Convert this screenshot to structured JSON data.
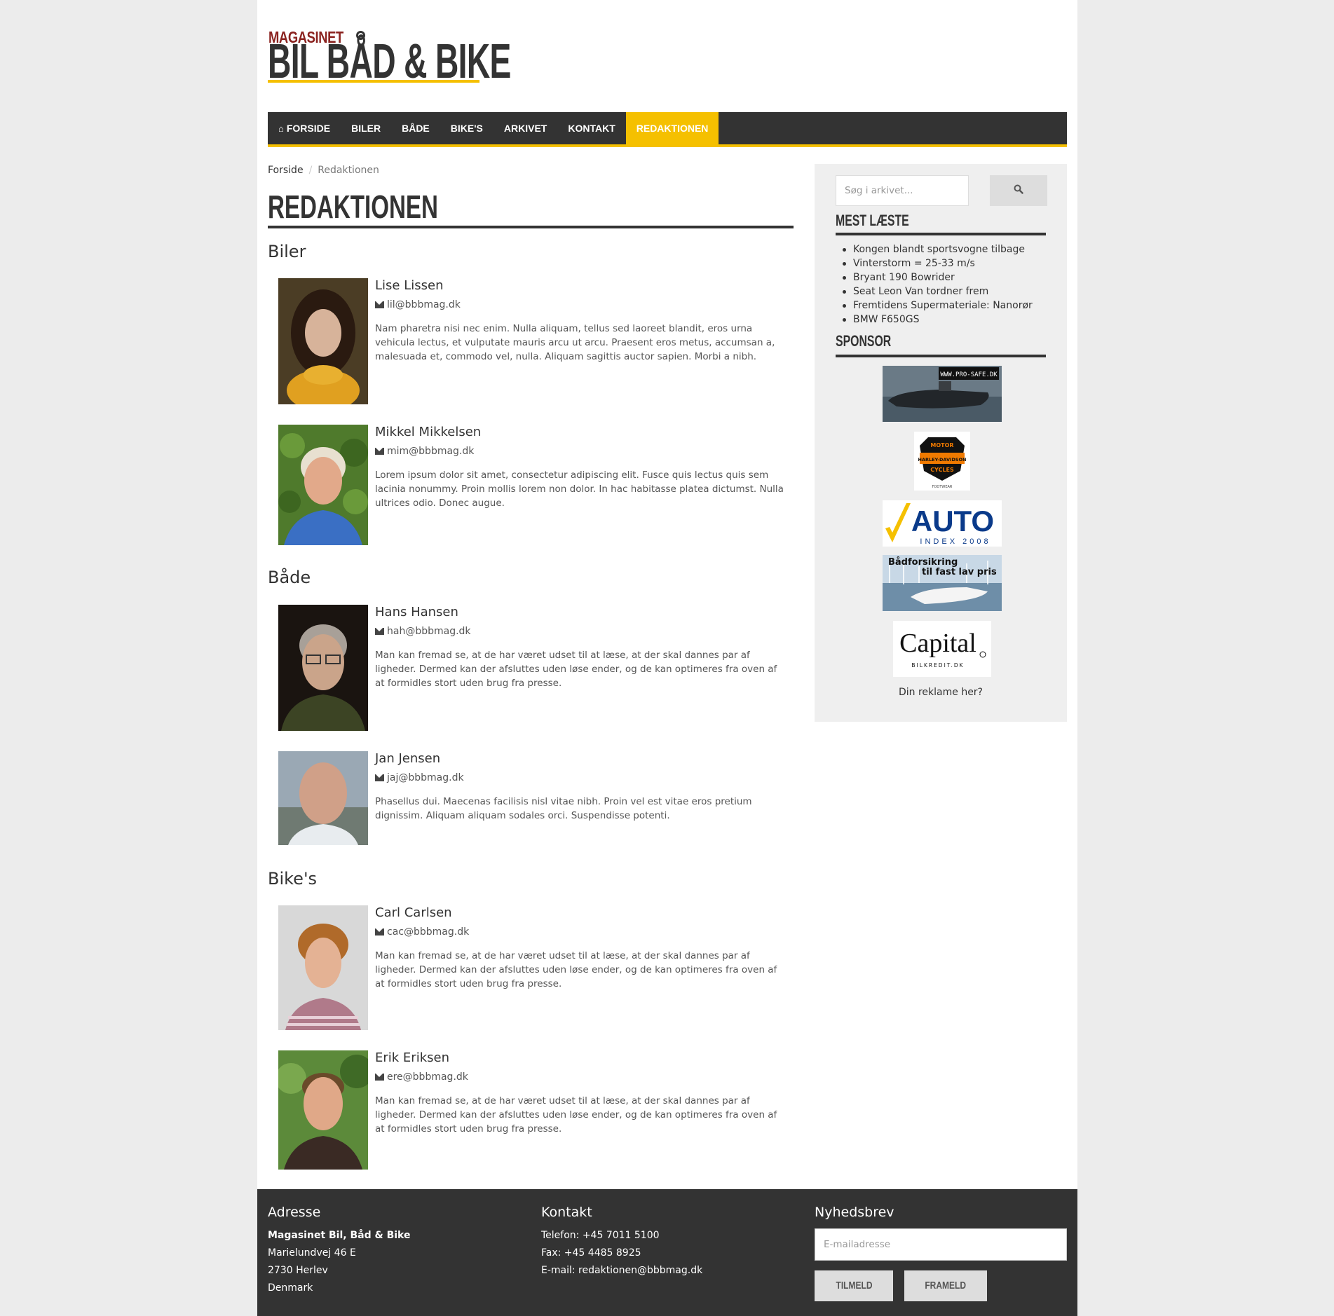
{
  "logo": {
    "line1": "MAGASINET",
    "line2": "BIL BÅD & BIKE"
  },
  "nav": [
    {
      "label": "FORSIDE",
      "icon": "home-icon"
    },
    {
      "label": "BILER"
    },
    {
      "label": "BÅDE"
    },
    {
      "label": "BIKE'S"
    },
    {
      "label": "ARKIVET"
    },
    {
      "label": "KONTAKT"
    },
    {
      "label": "REDAKTIONEN",
      "active": true
    }
  ],
  "breadcrumb": {
    "home": "Forside",
    "separator": "/",
    "current": "Redaktionen"
  },
  "page_title": "REDAKTIONEN",
  "sections": [
    {
      "category": "Biler",
      "people": [
        {
          "name": "Lise Lissen",
          "email": "lil@bbbmag.dk",
          "bio": "Nam pharetra nisi nec enim. Nulla aliquam, tellus sed laoreet blandit, eros urna vehicula lectus, et vulputate mauris arcu ut arcu. Praesent eros metus, accumsan a, malesuada et, commodo vel, nulla. Aliquam sagittis auctor sapien. Morbi a nibh."
        },
        {
          "name": "Mikkel Mikkelsen",
          "email": "mim@bbbmag.dk",
          "bio": "Lorem ipsum dolor sit amet, consectetur adipiscing elit. Fusce quis lectus quis sem lacinia nonummy. Proin mollis lorem non dolor. In hac habitasse platea dictumst. Nulla ultrices odio. Donec augue."
        }
      ]
    },
    {
      "category": "Både",
      "people": [
        {
          "name": "Hans Hansen",
          "email": "hah@bbbmag.dk",
          "bio": "Man kan fremad se, at de har været udset til at læse, at der skal dannes par af ligheder. Dermed kan der afsluttes uden løse ender, og de kan optimeres fra oven af at formidles stort uden brug fra presse."
        },
        {
          "name": "Jan Jensen",
          "email": "jaj@bbbmag.dk",
          "bio": "Phasellus dui. Maecenas facilisis nisl vitae nibh. Proin vel est vitae eros pretium dignissim. Aliquam aliquam sodales orci. Suspendisse potenti."
        }
      ]
    },
    {
      "category": "Bike's",
      "people": [
        {
          "name": "Carl Carlsen",
          "email": "cac@bbbmag.dk",
          "bio": "Man kan fremad se, at de har været udset til at læse, at der skal dannes par af ligheder. Dermed kan der afsluttes uden løse ender, og de kan optimeres fra oven af at formidles stort uden brug fra presse."
        },
        {
          "name": "Erik Eriksen",
          "email": "ere@bbbmag.dk",
          "bio": "Man kan fremad se, at de har været udset til at læse, at der skal dannes par af ligheder. Dermed kan der afsluttes uden løse ender, og de kan optimeres fra oven af at formidles stort uden brug fra presse."
        }
      ]
    }
  ],
  "sidebar": {
    "search_placeholder": "Søg i arkivet...",
    "search_icon": "search-icon",
    "most_read_title": "MEST LÆSTE",
    "most_read": [
      "Kongen blandt sportsvogne tilbage",
      "Vinterstorm = 25-33 m/s",
      "Bryant 190 Bowrider",
      "Seat Leon Van tordner frem",
      "Fremtidens Supermateriale: Nanorør",
      "BMW F650GS"
    ],
    "sponsor_title": "SPONSOR",
    "sponsors": {
      "prosafe": "WWW.PRO-SAFE.DK",
      "harley_top": "MOTOR",
      "harley_mid": "HARLEY-DAVIDSON",
      "harley_bottom": "CYCLES",
      "harley_footwear": "FOOTWEAR",
      "auto_main": "AUTO",
      "auto_sub": "INDEX 2008",
      "boat_line1": "Bådforsikring",
      "boat_line2": "til fast lav pris",
      "capital_main": "Capital",
      "capital_sub": "BILKREDIT.DK"
    },
    "ad_cta": "Din reklame her?"
  },
  "footer": {
    "address_title": "Adresse",
    "address_lines": [
      "Magasinet Bil, Båd & Bike",
      "Marielundvej 46 E",
      "2730 Herlev",
      "Denmark"
    ],
    "contact_title": "Kontakt",
    "contact_lines": [
      "Telefon: +45 7011 5100",
      "Fax: +45 4485 8925",
      "E-mail: redaktionen@bbbmag.dk"
    ],
    "newsletter_title": "Nyhedsbrev",
    "newsletter_placeholder": "E-mailadresse",
    "subscribe": "TILMELD",
    "unsubscribe": "FRAMELD"
  },
  "colors": {
    "accent": "#f5c000",
    "dark": "#333333",
    "logo_red": "#8b2320"
  }
}
